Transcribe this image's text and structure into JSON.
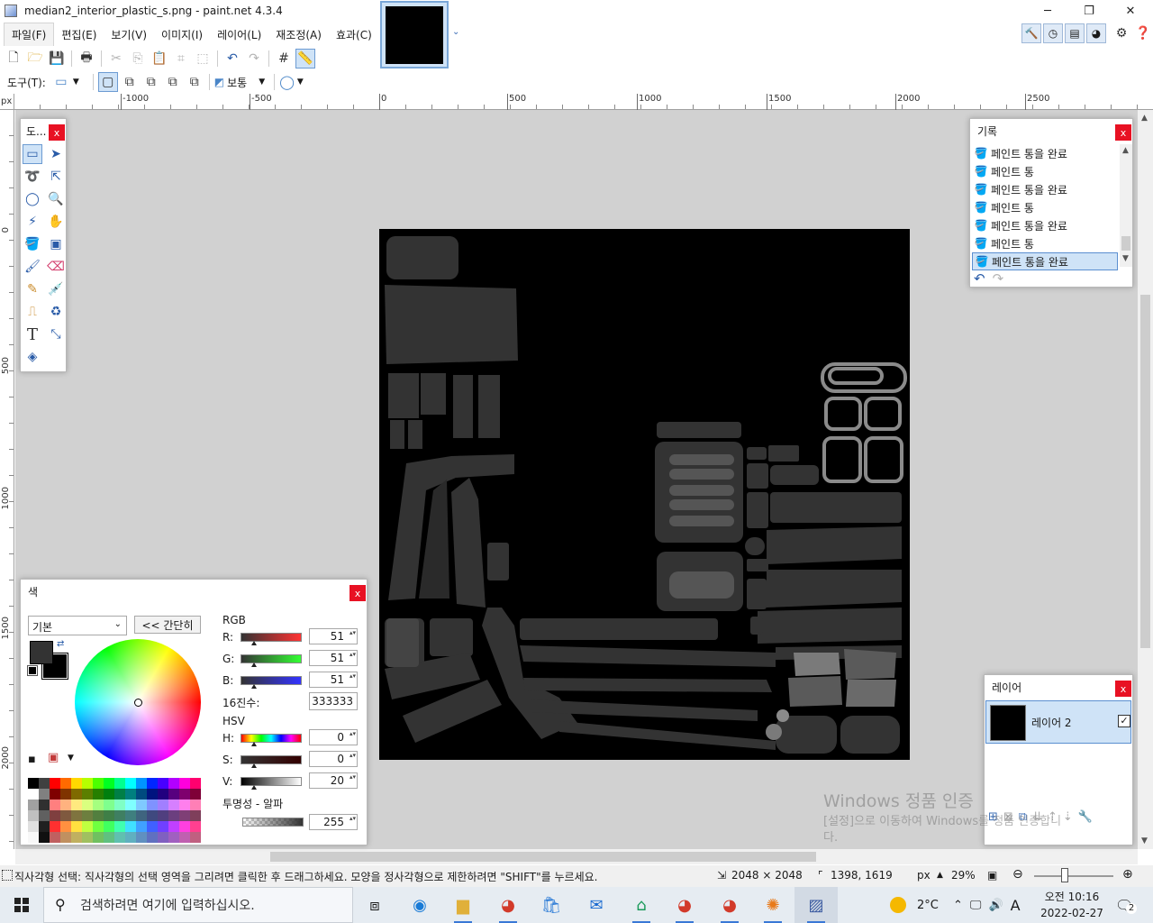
{
  "window": {
    "title": "median2_interior_plastic_s.png - paint.net 4.3.4",
    "minimize": "─",
    "maximize": "❐",
    "close": "✕"
  },
  "menu": [
    "파일(F)",
    "편집(E)",
    "보기(V)",
    "이미지(I)",
    "레이어(L)",
    "재조정(A)",
    "효과(C)"
  ],
  "toolbar2": {
    "tool_label": "도구(T):",
    "blend_mode": "보통"
  },
  "ruler": {
    "unit": "px",
    "top_labels": [
      "-1000",
      "-500",
      "0",
      "500",
      "1000",
      "1500",
      "2000",
      "2500"
    ],
    "left_labels": [
      "0",
      "500",
      "1000",
      "1500",
      "2000"
    ]
  },
  "tools_window": {
    "title": "도...",
    "close": "x"
  },
  "history_window": {
    "title": "기록",
    "close": "x",
    "items": [
      "페인트 통을 완료",
      "페인트 통",
      "페인트 통을 완료",
      "페인트 통",
      "페인트 통을 완료",
      "페인트 통",
      "페인트 통을 완료"
    ],
    "selected_index": 6
  },
  "color_window": {
    "title": "색",
    "close": "x",
    "palette_select": "기본",
    "simple_button": "<< 간단히",
    "rgb_label": "RGB",
    "r_label": "R:",
    "g_label": "G:",
    "b_label": "B:",
    "r": "51",
    "g": "51",
    "b": "51",
    "hex_label": "16진수:",
    "hex": "333333",
    "hsv_label": "HSV",
    "h_label": "H:",
    "s_label": "S:",
    "v_label": "V:",
    "h": "0",
    "s": "0",
    "v": "20",
    "alpha_label": "투명성 - 알파",
    "alpha": "255",
    "primary_color": "#333333",
    "secondary_color": "#000000"
  },
  "layers_window": {
    "title": "레이어",
    "close": "x",
    "layer_name": "레이어 2",
    "visible_check": "✓"
  },
  "watermark": {
    "line1": "Windows 정품 인증",
    "line2": "[설정]으로 이동하여 Windows를 정품 인증합니",
    "line3": "다."
  },
  "status": {
    "message": "직사각형 선택: 직사각형의 선택 영역을 그리려면 클릭한 후 드래그하세요. 모양을 정사각형으로 제한하려면 \"SHIFT\"를 누르세요.",
    "image_size": "2048 × 2048",
    "cursor": "1398, 1619",
    "unit": "px",
    "zoom": "29%"
  },
  "taskbar": {
    "search_placeholder": "검색하려면 여기에 입력하십시오.",
    "weather": "2°C",
    "time": "오전 10:16",
    "date": "2022-02-27",
    "ime": "A",
    "notifications": "2"
  },
  "colors": {
    "workspace": "#d1d1d1",
    "accent": "#0078d7",
    "selection": "#cfe3f7",
    "uv_island": "#333333"
  }
}
